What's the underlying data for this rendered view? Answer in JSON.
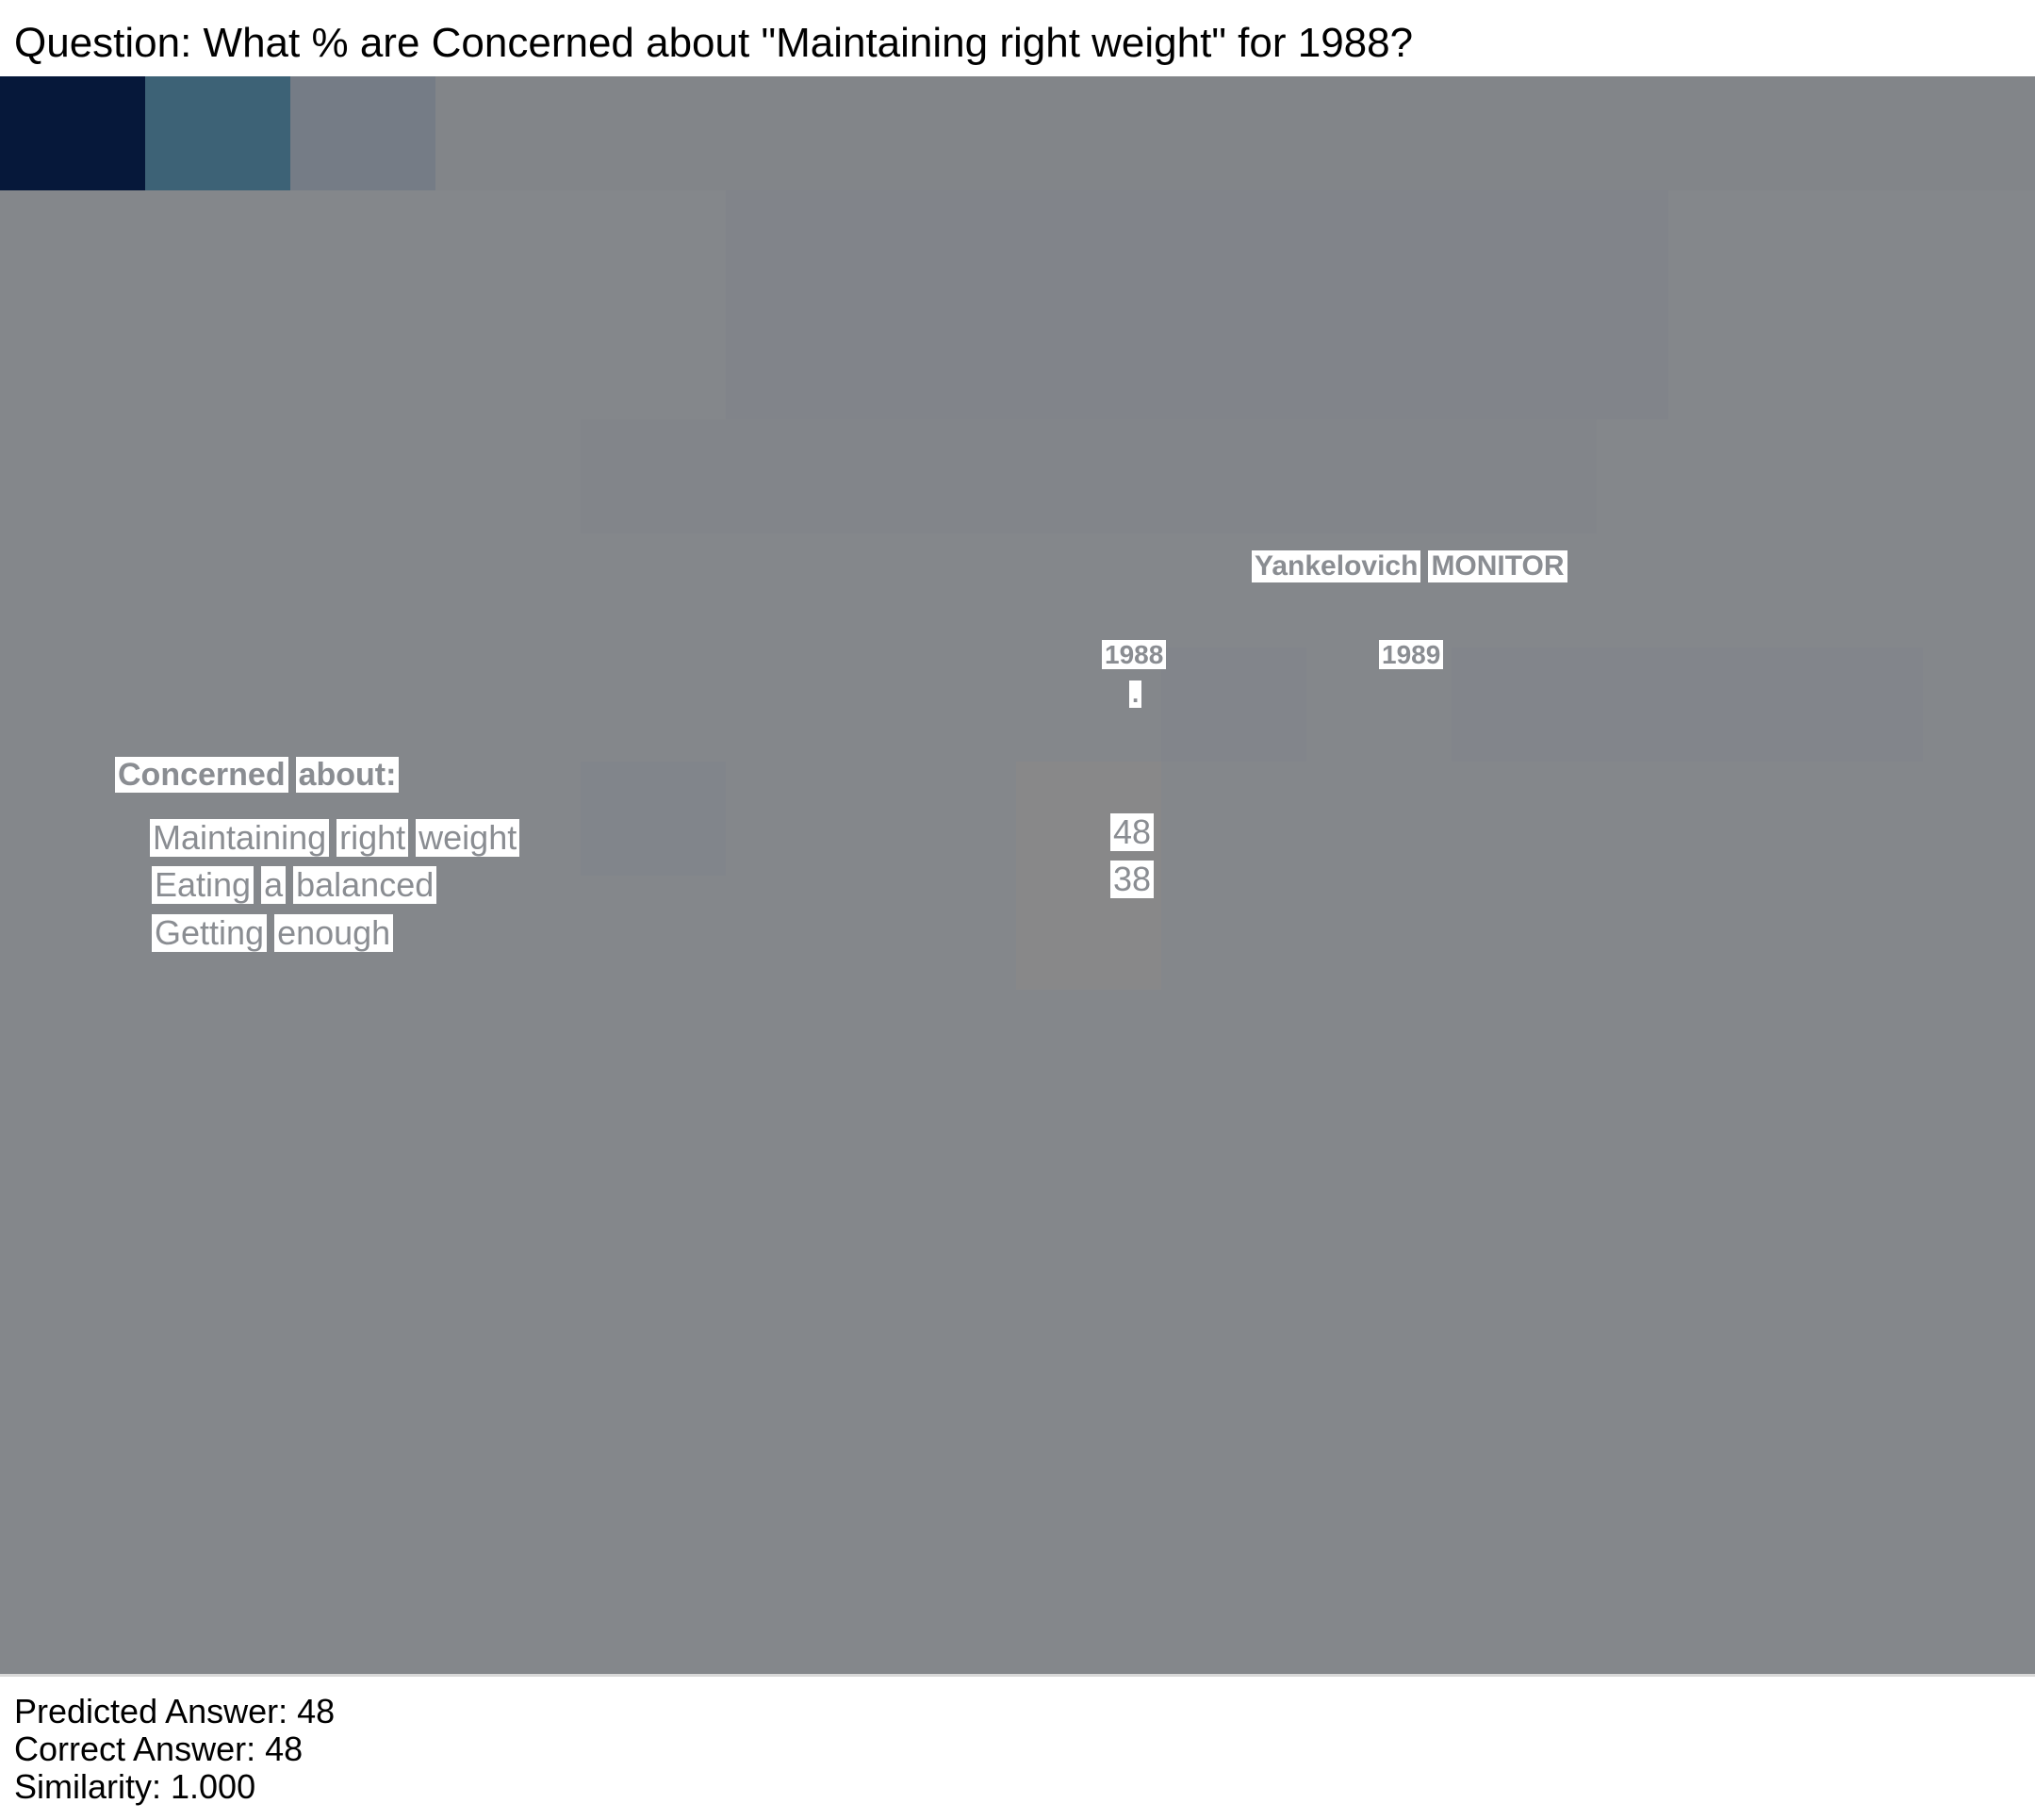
{
  "question": "Question: What % are Concerned about \"Maintaining right weight\" for 1988?",
  "document": {
    "colors": {
      "background": "#84878b",
      "swatch_1": "#06183a",
      "swatch_2": "#3d6276",
      "swatch_3": "#757c86",
      "word_box": "#ffffff",
      "word_text": "#8a8d92"
    },
    "header": {
      "words": [
        "Yankelovich",
        "MONITOR"
      ]
    },
    "columns": {
      "year_1988": "1988",
      "year_1989": "1989",
      "fragment": "."
    },
    "section": {
      "heading_words": [
        "Concerned",
        "about:"
      ],
      "items": [
        {
          "words": [
            "Maintaining",
            "right",
            "weight"
          ],
          "value_1988": "48"
        },
        {
          "words": [
            "Eating",
            "a",
            "balanced"
          ],
          "value_1988": "38"
        },
        {
          "words": [
            "Getting",
            "enough"
          ]
        }
      ]
    }
  },
  "footer": {
    "predicted": "Predicted Answer: 48",
    "correct": "Correct Answer: 48",
    "similarity": "Similarity: 1.000"
  }
}
